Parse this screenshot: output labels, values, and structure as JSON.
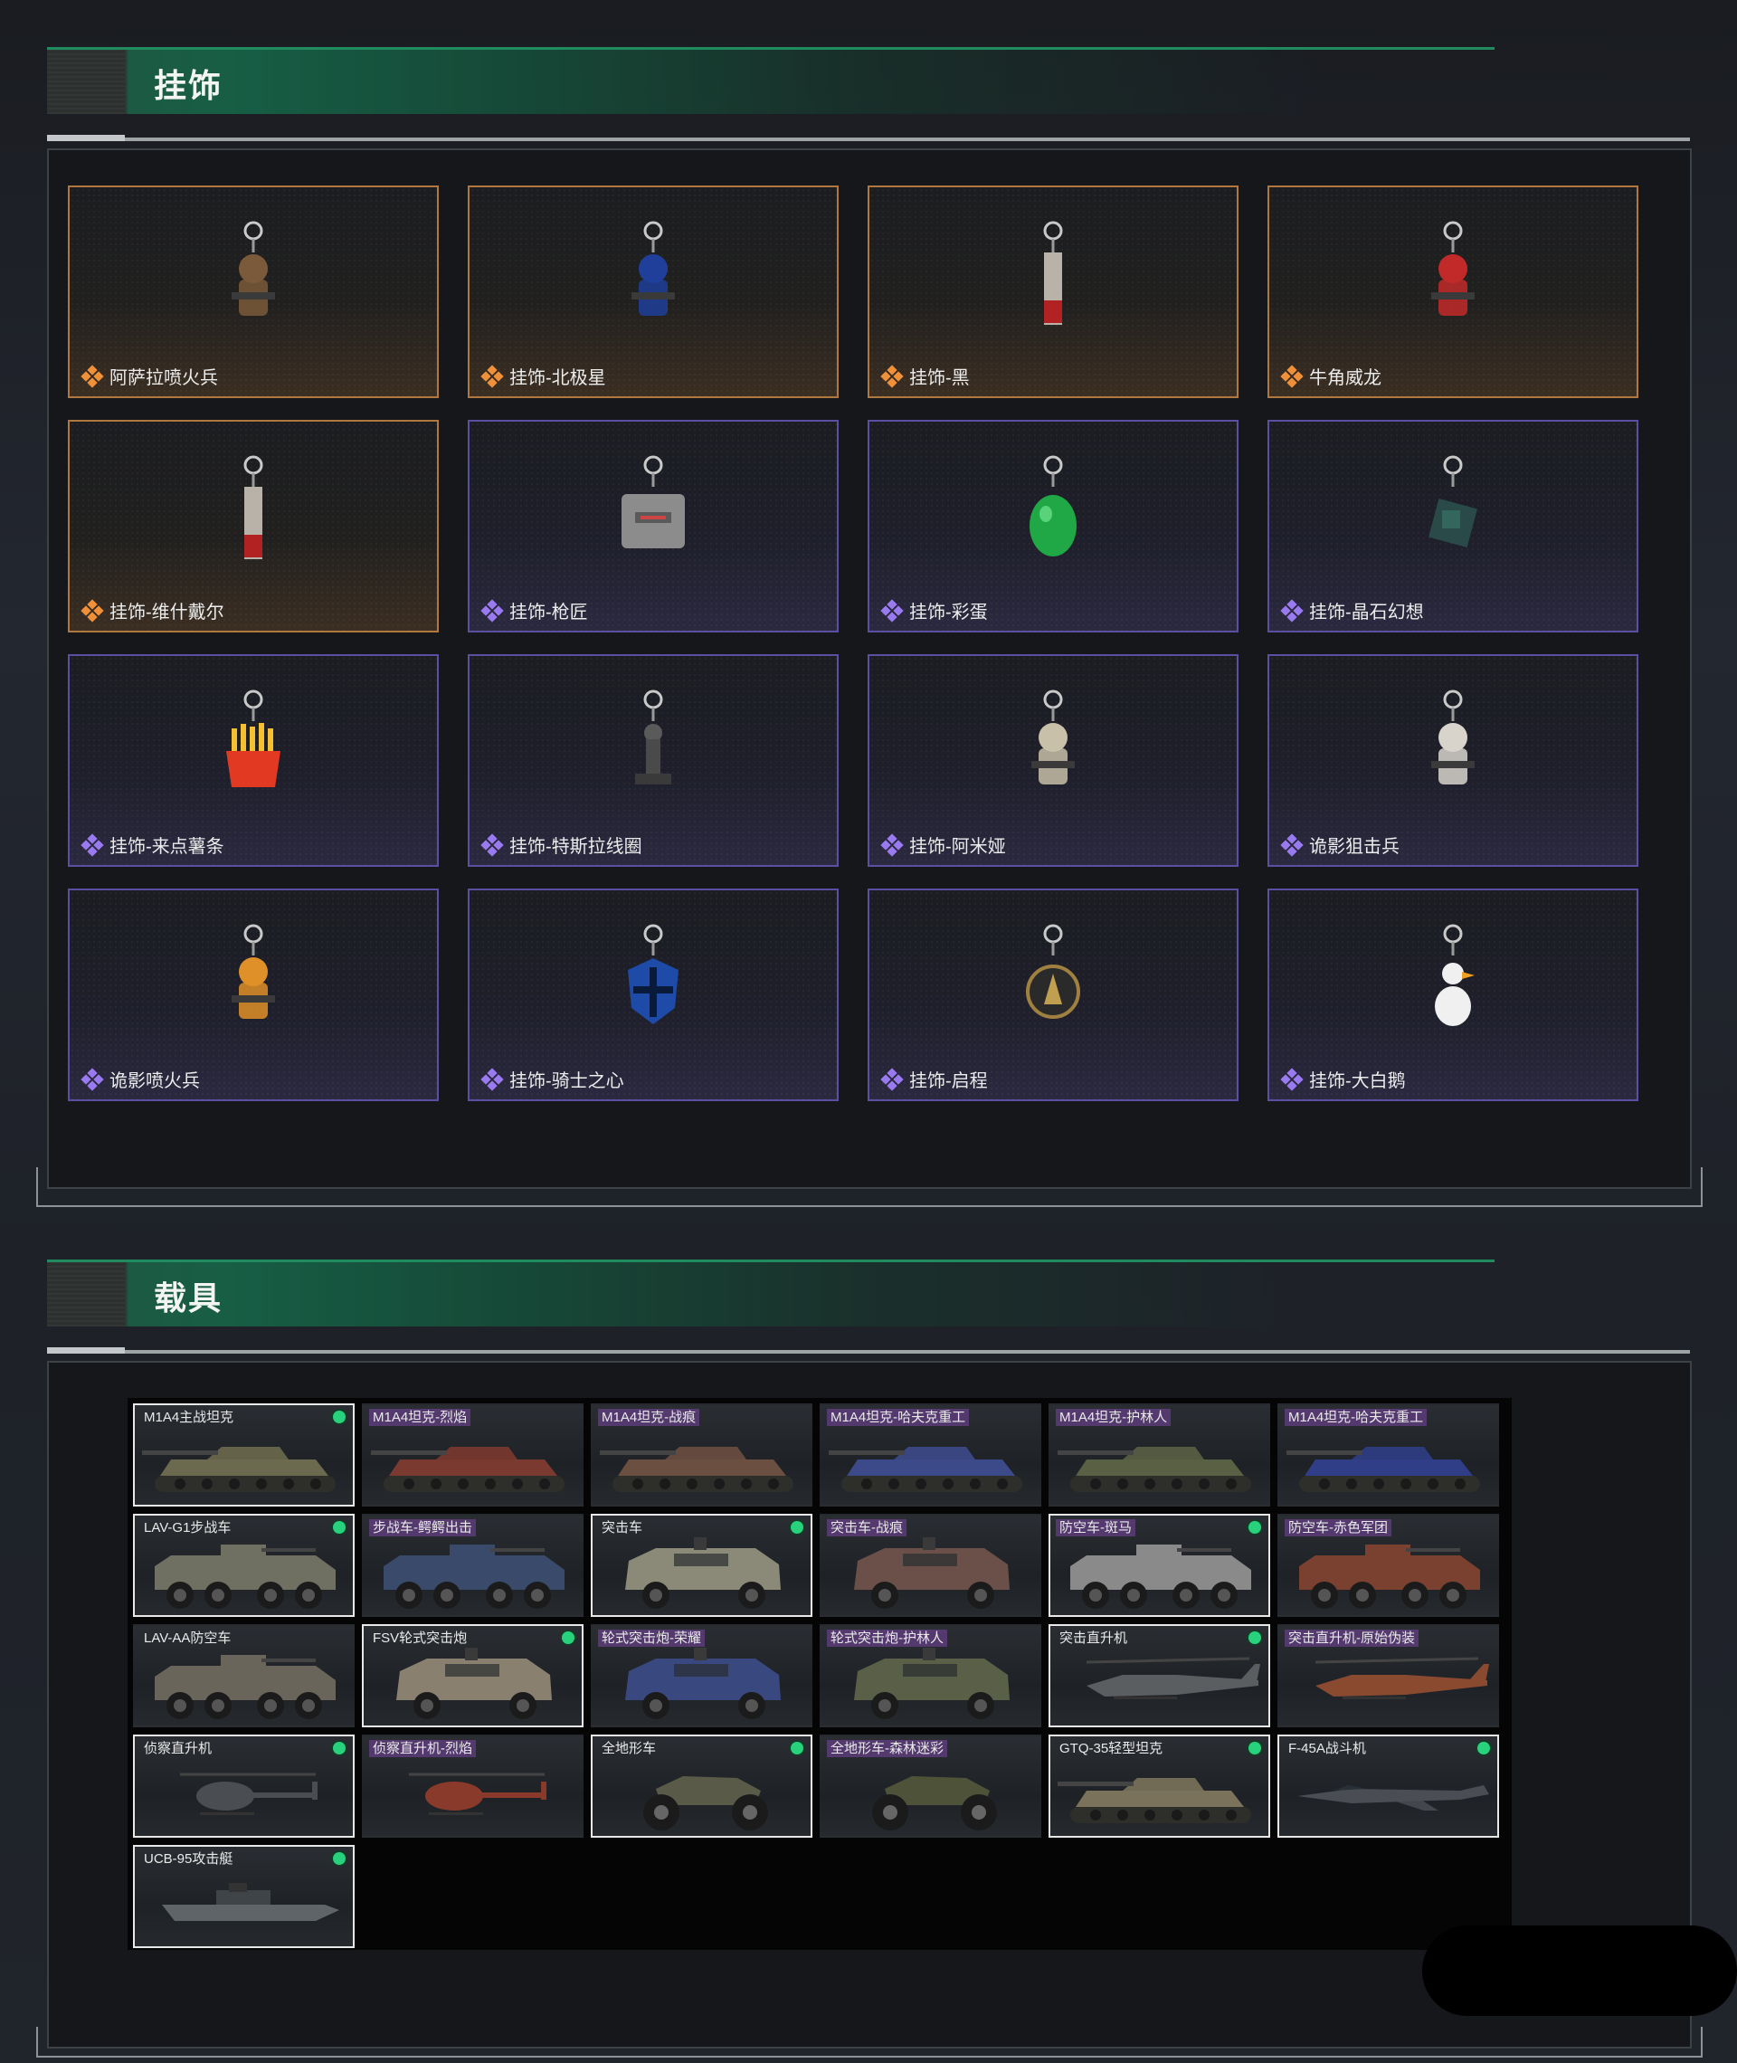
{
  "sections": {
    "charms": {
      "title": "挂饰"
    },
    "vehicles": {
      "title": "载具"
    }
  },
  "charms": [
    {
      "name": "阿萨拉喷火兵",
      "rarity": "gold",
      "icon": "flamethrower-soldier-charm-icon"
    },
    {
      "name": "挂饰-北极星",
      "rarity": "gold",
      "icon": "polaris-charm-icon"
    },
    {
      "name": "挂饰-黑",
      "rarity": "gold",
      "icon": "black-tag-charm-icon"
    },
    {
      "name": "牛角威龙",
      "rarity": "gold",
      "icon": "horned-dragon-charm-icon"
    },
    {
      "name": "挂饰-维什戴尔",
      "rarity": "gold",
      "icon": "wisdel-tag-charm-icon"
    },
    {
      "name": "挂饰-枪匠",
      "rarity": "purple",
      "icon": "gunsmith-case-charm-icon"
    },
    {
      "name": "挂饰-彩蛋",
      "rarity": "purple",
      "icon": "easter-egg-charm-icon"
    },
    {
      "name": "挂饰-晶石幻想",
      "rarity": "purple",
      "icon": "crystal-cube-charm-icon"
    },
    {
      "name": "挂饰-来点薯条",
      "rarity": "purple",
      "icon": "fries-charm-icon"
    },
    {
      "name": "挂饰-特斯拉线圈",
      "rarity": "purple",
      "icon": "tesla-coil-charm-icon"
    },
    {
      "name": "挂饰-阿米娅",
      "rarity": "purple",
      "icon": "amiya-charm-icon"
    },
    {
      "name": "诡影狙击兵",
      "rarity": "purple",
      "icon": "ghost-sniper-charm-icon"
    },
    {
      "name": "诡影喷火兵",
      "rarity": "purple",
      "icon": "ghost-flamethrower-charm-icon"
    },
    {
      "name": "挂饰-骑士之心",
      "rarity": "purple",
      "icon": "knight-heart-charm-icon"
    },
    {
      "name": "挂饰-启程",
      "rarity": "purple",
      "icon": "departure-medal-charm-icon"
    },
    {
      "name": "挂饰-大白鹅",
      "rarity": "purple",
      "icon": "white-goose-charm-icon"
    }
  ],
  "vehicles": [
    {
      "name": "M1A4主战坦克",
      "owned": true,
      "skin": false,
      "kind": "tank",
      "color": "#6b6a4e"
    },
    {
      "name": "M1A4坦克-烈焰",
      "owned": false,
      "skin": true,
      "kind": "tank",
      "color": "#7a3a30"
    },
    {
      "name": "M1A4坦克-战痕",
      "owned": false,
      "skin": true,
      "kind": "tank",
      "color": "#6b4f40"
    },
    {
      "name": "M1A4坦克-哈夫克重工",
      "owned": false,
      "skin": true,
      "kind": "tank",
      "color": "#3c4a8a"
    },
    {
      "name": "M1A4坦克-护林人",
      "owned": false,
      "skin": true,
      "kind": "tank",
      "color": "#5a6044"
    },
    {
      "name": "M1A4坦克-哈夫克重工",
      "owned": false,
      "skin": true,
      "kind": "tank",
      "color": "#2f3e86"
    },
    {
      "name": "LAV-G1步战车",
      "owned": true,
      "skin": false,
      "kind": "apc",
      "color": "#6f6f62"
    },
    {
      "name": "步战车-鳄鳄出击",
      "owned": false,
      "skin": true,
      "kind": "apc",
      "color": "#3a4a6a"
    },
    {
      "name": "突击车",
      "owned": true,
      "skin": false,
      "kind": "armored-car",
      "color": "#8b8a78"
    },
    {
      "name": "突击车-战痕",
      "owned": false,
      "skin": true,
      "kind": "armored-car",
      "color": "#6a5048"
    },
    {
      "name": "防空车-斑马",
      "owned": true,
      "skin": true,
      "kind": "apc",
      "color": "#8a8a8a"
    },
    {
      "name": "防空车-赤色军团",
      "owned": false,
      "skin": true,
      "kind": "apc",
      "color": "#7a4030"
    },
    {
      "name": "LAV-AA防空车",
      "owned": false,
      "skin": false,
      "kind": "apc",
      "color": "#6a655a"
    },
    {
      "name": "FSV轮式突击炮",
      "owned": true,
      "skin": false,
      "kind": "armored-car",
      "color": "#8a8070"
    },
    {
      "name": "轮式突击炮-荣耀",
      "owned": false,
      "skin": true,
      "kind": "armored-car",
      "color": "#3a4880"
    },
    {
      "name": "轮式突击炮-护林人",
      "owned": false,
      "skin": true,
      "kind": "armored-car",
      "color": "#5a6048"
    },
    {
      "name": "突击直升机",
      "owned": true,
      "skin": false,
      "kind": "helicopter",
      "color": "#5a5e60"
    },
    {
      "name": "突击直升机-原始伪装",
      "owned": false,
      "skin": true,
      "kind": "helicopter",
      "color": "#8a4a30"
    },
    {
      "name": "侦察直升机",
      "owned": true,
      "skin": false,
      "kind": "small-heli",
      "color": "#4a4e52"
    },
    {
      "name": "侦察直升机-烈焰",
      "owned": false,
      "skin": true,
      "kind": "small-heli",
      "color": "#8a3a2a"
    },
    {
      "name": "全地形车",
      "owned": true,
      "skin": false,
      "kind": "atv",
      "color": "#5a5a48"
    },
    {
      "name": "全地形车-森林迷彩",
      "owned": false,
      "skin": true,
      "kind": "atv",
      "color": "#4e5238"
    },
    {
      "name": "GTQ-35轻型坦克",
      "owned": true,
      "skin": false,
      "kind": "tank",
      "color": "#7a725a"
    },
    {
      "name": "F-45A战斗机",
      "owned": true,
      "skin": false,
      "kind": "jet",
      "color": "#4a4e54"
    },
    {
      "name": "UCB-95攻击艇",
      "owned": true,
      "skin": false,
      "kind": "boat",
      "color": "#5e6468"
    }
  ]
}
